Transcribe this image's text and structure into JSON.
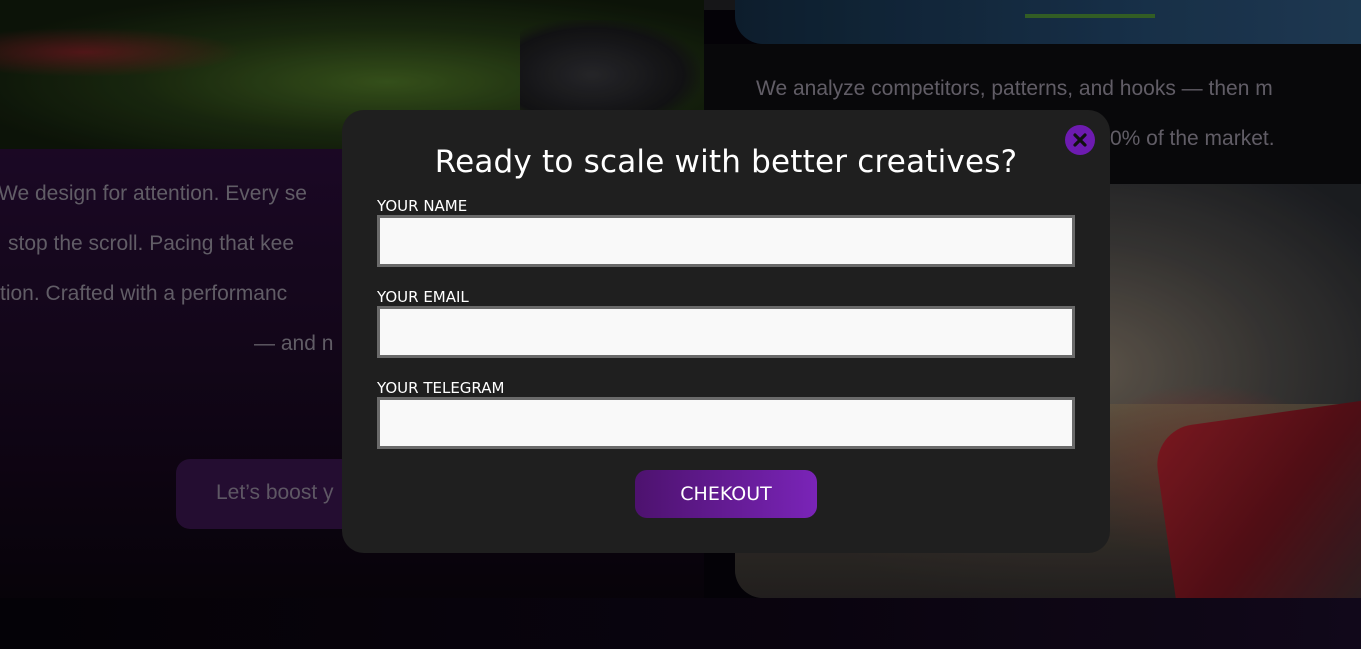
{
  "background": {
    "left_paragraph_lines": [
      "We design for attention. Every se",
      "stop the scroll. Pacing that kee",
      "tion. Crafted with a performanc",
      "— and n"
    ],
    "left_button_label": "Let’s boost y",
    "right_paragraph_lines": [
      "We analyze competitors, patterns, and hooks — then m",
      "0% of the market."
    ],
    "image_left": "game-art-dragon-creature",
    "image_right": "game-art-fps-gun-scene"
  },
  "modal": {
    "title": "Ready to scale with better creatives?",
    "close_icon": "close-x-icon",
    "fields": [
      {
        "label": "YOUR NAME",
        "value": ""
      },
      {
        "label": "YOUR EMAIL",
        "value": ""
      },
      {
        "label": "YOUR TELEGRAM",
        "value": ""
      }
    ],
    "submit_label": "CHEKOUT"
  },
  "colors": {
    "accent_purple": "#6d1bb0",
    "modal_bg": "#1f1f1f",
    "button_gradient_start": "#4d126e",
    "button_gradient_end": "#7a24b8"
  }
}
